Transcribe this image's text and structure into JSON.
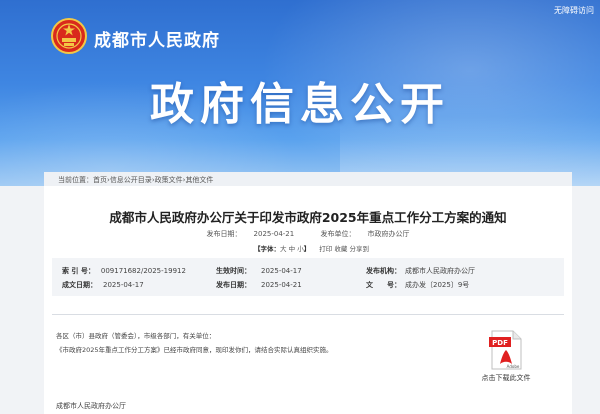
{
  "header": {
    "accessible_link": "无障碍访问",
    "site_title": "成都市人民政府",
    "section_title": "政府信息公开",
    "emblem_icon": "national-emblem-icon"
  },
  "breadcrumb": {
    "prefix": "当前位置：",
    "items": [
      "首页",
      "信息公开目录",
      "政策文件",
      "其他文件"
    ],
    "separator": " › "
  },
  "document": {
    "title": "成都市人民政府办公厅关于印发市政府2025年重点工作分工方案的通知",
    "publish_date_label": "发布日期：",
    "publish_date": "2025-04-21",
    "publisher_label": "发布单位：",
    "publisher": "市政府办公厅",
    "font_size_label": "【字体：",
    "font_sizes": [
      "大",
      "中",
      "小"
    ],
    "font_size_close": "】",
    "print_label": "打印",
    "favorite_label": "收藏",
    "share_label": "分享到"
  },
  "meta": {
    "index_label": "索 引 号：",
    "index_value": "009171682/2025-19912",
    "effective_label": "生效时间：",
    "effective_value": "2025-04-17",
    "issuer_label": "发布机构：",
    "issuer_value": "成都市人民政府办公厅",
    "created_label": "成文日期：",
    "created_value": "2025-04-17",
    "published_label": "发布日期：",
    "published_value": "2025-04-21",
    "docno_label": "文　　号：",
    "docno_value": "成办发〔2025〕9号"
  },
  "body": {
    "line1": "各区（市）县政府（管委会），市级各部门，有关单位：",
    "line2": "《市政府2025年重点工作分工方案》已经市政府同意，现印发你们，请结合实际认真组织实施。",
    "signoff": "成都市人民政府办公厅"
  },
  "attachment": {
    "icon": "pdf-file-icon",
    "label": "点击下载此文件"
  },
  "colors": {
    "banner_top": "#2f6fd0",
    "banner_bottom": "#9cc8f3",
    "pdf_red": "#e02020"
  }
}
